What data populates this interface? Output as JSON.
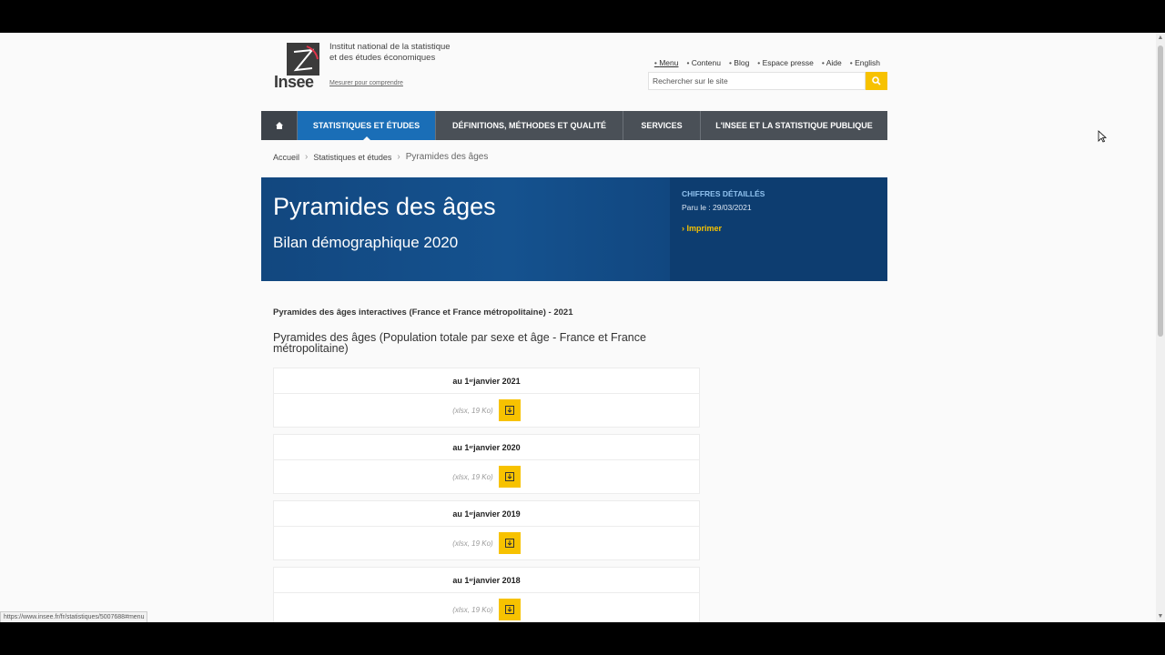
{
  "header": {
    "logo_word": "Insee",
    "institute_line1": "Institut national de la statistique",
    "institute_line2": "et des études économiques",
    "tagline": "Mesurer pour comprendre"
  },
  "top_links": [
    "Menu",
    "Contenu",
    "Blog",
    "Espace presse",
    "Aide",
    "English"
  ],
  "search": {
    "placeholder": "Rechercher sur le site"
  },
  "nav": {
    "stats": "STATISTIQUES ET ÉTUDES",
    "definitions": "DÉFINITIONS, MÉTHODES ET QUALITÉ",
    "services": "SERVICES",
    "insee": "L'INSEE ET LA STATISTIQUE PUBLIQUE"
  },
  "breadcrumb": [
    "Accueil",
    "Statistiques et études",
    "Pyramides des âges"
  ],
  "banner": {
    "title": "Pyramides des âges",
    "subtitle": "Bilan démographique 2020",
    "category": "CHIFFRES DÉTAILLÉS",
    "published": "Paru le : 29/03/2021",
    "print": "Imprimer"
  },
  "section": {
    "title": "Pyramides des âges interactives (France et France métropolitaine) - 2021",
    "subtitle": "Pyramides des âges (Population totale par sexe et âge - France et France métropolitaine)"
  },
  "files": [
    {
      "prefix": "au 1",
      "sup": "er",
      "label": " janvier 2021",
      "meta": "(xlsx, 19 Ko)"
    },
    {
      "prefix": "au 1",
      "sup": "er",
      "label": " janvier 2020",
      "meta": "(xlsx, 19 Ko)"
    },
    {
      "prefix": "au 1",
      "sup": "er",
      "label": " janvier 2019",
      "meta": "(xlsx, 19 Ko)"
    },
    {
      "prefix": "au 1",
      "sup": "er",
      "label": " janvier 2018",
      "meta": "(xlsx, 19 Ko)"
    }
  ],
  "status_url": "https://www.insee.fr/fr/statistiques/5007688#menu",
  "colors": {
    "accent_yellow": "#f7c200",
    "nav_active": "#1a6eb7",
    "banner": "#10457c"
  }
}
